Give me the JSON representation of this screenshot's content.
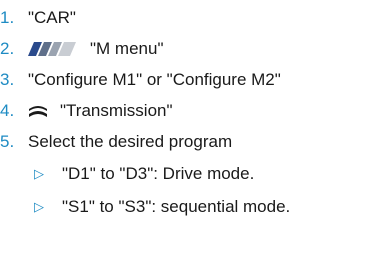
{
  "steps": [
    {
      "number": "1.",
      "text": "\"CAR\""
    },
    {
      "number": "2.",
      "text": "\"M menu\"",
      "icon": "m-logo-icon"
    },
    {
      "number": "3.",
      "text": "\"Configure M1\" or \"Configure M2\""
    },
    {
      "number": "4.",
      "text": "\"Transmission\"",
      "icon": "transmission-icon"
    },
    {
      "number": "5.",
      "text": "Select the desired program"
    }
  ],
  "substeps": [
    {
      "bullet": "▷",
      "text": "\"D1\" to \"D3\": Drive mode."
    },
    {
      "bullet": "▷",
      "text": "\"S1\" to \"S3\": sequential mode."
    }
  ],
  "colors": {
    "accent": "#1e8bc3",
    "text": "#1a1a1a"
  }
}
